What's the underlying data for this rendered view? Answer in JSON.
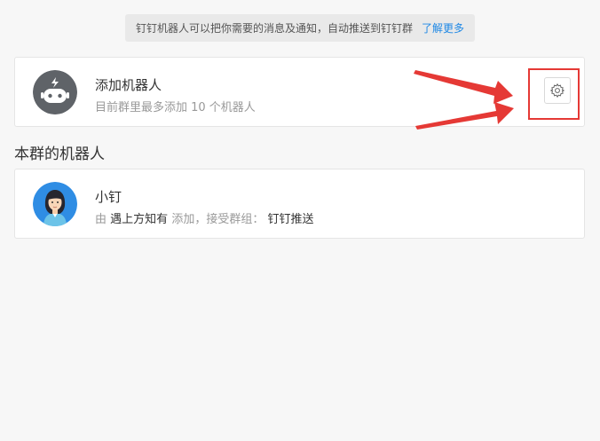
{
  "notice": {
    "text": "钉钉机器人可以把你需要的消息及通知，自动推送到钉钉群",
    "link_label": "了解更多"
  },
  "add_robot": {
    "title": "添加机器人",
    "subtitle": "目前群里最多添加 10 个机器人",
    "settings_icon": "gear-icon",
    "avatar_icon": "robot-icon"
  },
  "section": {
    "title": "本群的机器人"
  },
  "robots": [
    {
      "name": "小钉",
      "by_prefix": "由",
      "creator": "遇上方知有",
      "added_text": "添加，接受群组：",
      "group": "钉钉推送"
    }
  ],
  "colors": {
    "accent": "#1e88e5",
    "highlight": "#e53935",
    "page_bg": "#f7f7f7"
  }
}
